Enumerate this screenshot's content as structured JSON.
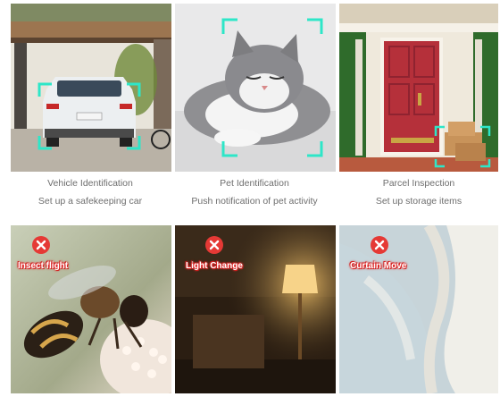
{
  "features": [
    {
      "title": "Vehicle Identification",
      "subtitle": "Set up a safekeeping car",
      "icon": "car-photo"
    },
    {
      "title": "Pet Identification",
      "subtitle": "Push notification of pet activity",
      "icon": "cat-photo"
    },
    {
      "title": "Parcel Inspection",
      "subtitle": "Set up storage items",
      "icon": "door-parcel-photo"
    }
  ],
  "false_alarms": [
    {
      "label": "Insect flight",
      "icon": "red-x-icon"
    },
    {
      "label": "Light Change",
      "icon": "red-x-icon"
    },
    {
      "label": "Curtain Move",
      "icon": "red-x-icon"
    }
  ],
  "colors": {
    "detect_frame": "#2ee6c8",
    "alert_red": "#e53935",
    "caption_text": "#6e6e6e"
  }
}
